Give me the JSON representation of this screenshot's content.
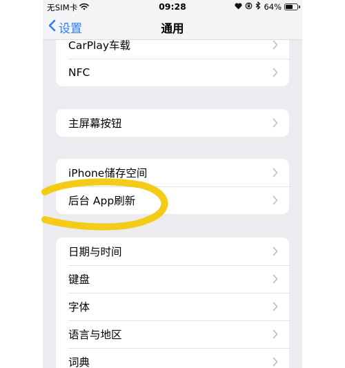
{
  "status_bar": {
    "carrier": "无SIM卡",
    "time": "09:28",
    "battery_text": "64%",
    "battery_level": 0.64
  },
  "nav": {
    "back_label": "设置",
    "title": "通用"
  },
  "groups": [
    {
      "items": [
        {
          "label": "CarPlay车载"
        },
        {
          "label": "NFC"
        }
      ]
    },
    {
      "items": [
        {
          "label": "主屏幕按钮"
        }
      ]
    },
    {
      "items": [
        {
          "label": "iPhone储存空间"
        },
        {
          "label": "后台 App刷新"
        }
      ]
    },
    {
      "items": [
        {
          "label": "日期与时间"
        },
        {
          "label": "键盘"
        },
        {
          "label": "字体"
        },
        {
          "label": "语言与地区"
        },
        {
          "label": "词典"
        }
      ]
    }
  ],
  "annotation": {
    "type": "highlight-ellipse",
    "target": "后台 App刷新",
    "color": "#f3cb18"
  },
  "colors": {
    "accent": "#2f7cf6",
    "background": "#ececf0",
    "separator": "#e2e2e6",
    "chevron": "#c4c4c8"
  }
}
